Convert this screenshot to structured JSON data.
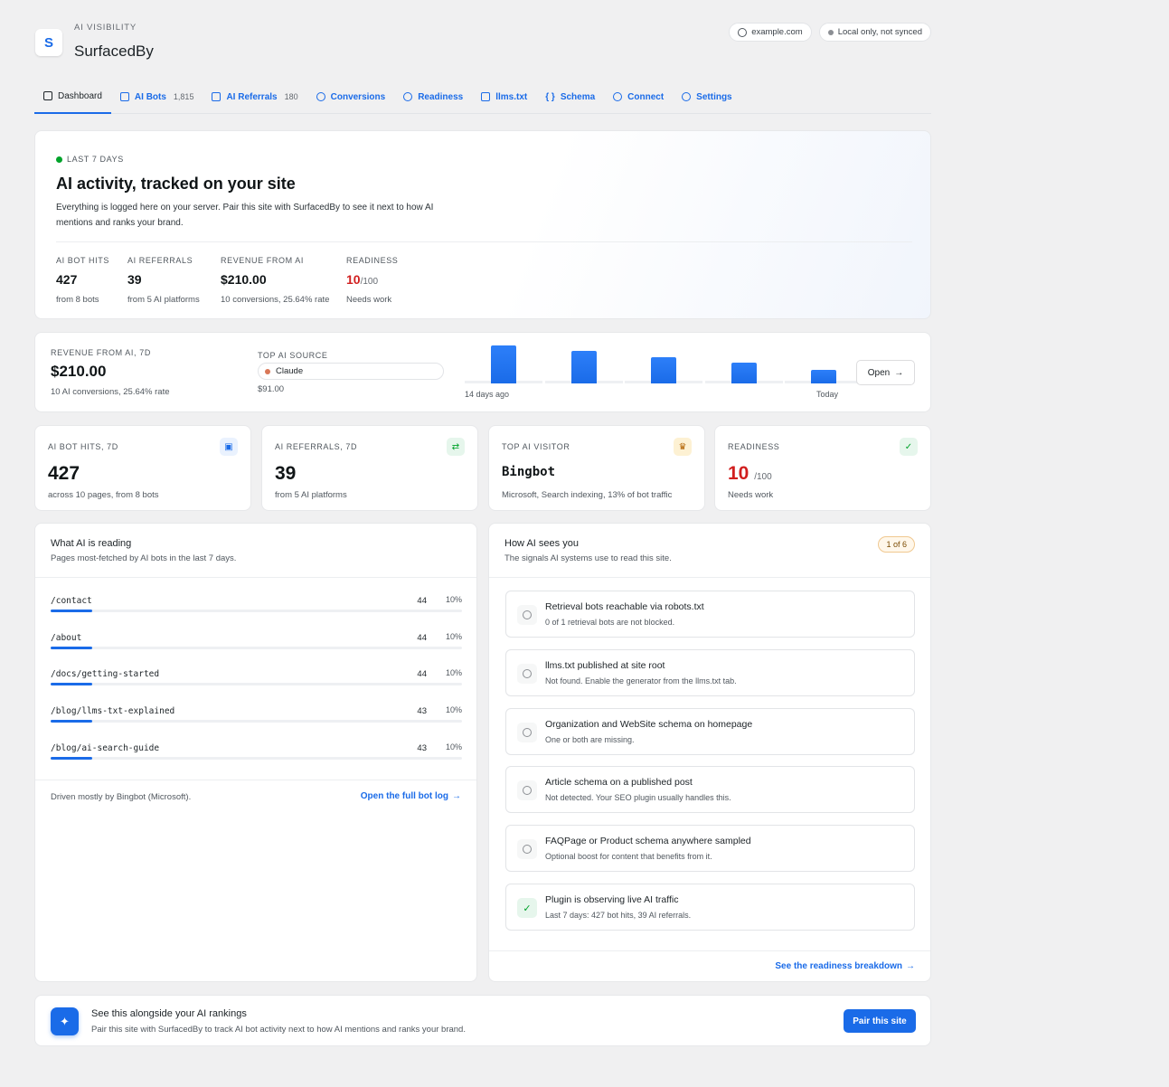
{
  "header": {
    "logo_letter": "S",
    "eyebrow": "AI VISIBILITY",
    "brand": "SurfacedBy",
    "domain_chip": "example.com",
    "sync_chip": "Local only, not synced"
  },
  "tabs": [
    {
      "label": "Dashboard",
      "count": ""
    },
    {
      "label": "AI Bots",
      "count": "1,815"
    },
    {
      "label": "AI Referrals",
      "count": "180"
    },
    {
      "label": "Conversions",
      "count": ""
    },
    {
      "label": "Readiness",
      "count": ""
    },
    {
      "label": "llms.txt",
      "count": ""
    },
    {
      "label": "Schema",
      "count": ""
    },
    {
      "label": "Connect",
      "count": ""
    },
    {
      "label": "Settings",
      "count": ""
    }
  ],
  "hero": {
    "period": "LAST 7 DAYS",
    "title": "AI activity, tracked on your site",
    "description": "Everything is logged here on your server. Pair this site with SurfacedBy to see it next to how AI mentions and ranks your brand.",
    "kpis": [
      {
        "label": "AI BOT HITS",
        "value": "427",
        "sub": "from 8 bots"
      },
      {
        "label": "AI REFERRALS",
        "value": "39",
        "sub": "from 5 AI platforms"
      },
      {
        "label": "REVENUE FROM AI",
        "value": "$210.00",
        "sub": "10 conversions, 25.64% rate"
      },
      {
        "label": "READINESS",
        "value": "10",
        "denominator": "/100",
        "sub": "Needs work"
      }
    ]
  },
  "revenue": {
    "label": "REVENUE FROM AI, 7D",
    "value": "$210.00",
    "sub": "10 AI conversions, 25.64% rate",
    "top_source_label": "TOP AI SOURCE",
    "top_source_name": "Claude",
    "top_source_value": "$91.00",
    "axis_start": "14 days ago",
    "axis_end": "Today",
    "open_label": "Open",
    "bar_levels": [
      1.0,
      0.85,
      0.7,
      0.55,
      0.35
    ]
  },
  "stats": [
    {
      "label": "AI BOT HITS, 7D",
      "value": "427",
      "sub": "across 10 pages, from 8 bots",
      "icon": "bot-icon"
    },
    {
      "label": "AI REFERRALS, 7D",
      "value": "39",
      "sub": "from 5 AI platforms",
      "icon": "referral-icon"
    },
    {
      "label": "TOP AI VISITOR",
      "value": "Bingbot",
      "sub": "Microsoft, Search indexing, 13% of bot traffic",
      "icon": "crown-icon"
    },
    {
      "label": "READINESS",
      "value": "10",
      "denominator": "/100",
      "sub": "Needs work",
      "icon": "check-circle-icon"
    }
  ],
  "reading": {
    "title": "What AI is reading",
    "desc": "Pages most-fetched by AI bots in the last 7 days.",
    "rows": [
      {
        "path": "/contact",
        "count": "44",
        "pct": "10%",
        "fill": 0.1
      },
      {
        "path": "/about",
        "count": "44",
        "pct": "10%",
        "fill": 0.1
      },
      {
        "path": "/docs/getting-started",
        "count": "44",
        "pct": "10%",
        "fill": 0.1
      },
      {
        "path": "/blog/llms-txt-explained",
        "count": "43",
        "pct": "10%",
        "fill": 0.1
      },
      {
        "path": "/blog/ai-search-guide",
        "count": "43",
        "pct": "10%",
        "fill": 0.1
      }
    ],
    "footer": "Driven mostly by Bingbot (Microsoft).",
    "link": "Open the full bot log"
  },
  "sees": {
    "title": "How AI sees you",
    "desc": "The signals AI systems use to read this site.",
    "progress": "1 of 6",
    "checks": [
      {
        "title": "Retrieval bots reachable via robots.txt",
        "desc": "0 of 1 retrieval bots are not blocked.",
        "done": false
      },
      {
        "title": "llms.txt published at site root",
        "desc": "Not found. Enable the generator from the llms.txt tab.",
        "done": false
      },
      {
        "title": "Organization and WebSite schema on homepage",
        "desc": "One or both are missing.",
        "done": false
      },
      {
        "title": "Article schema on a published post",
        "desc": "Not detected. Your SEO plugin usually handles this.",
        "done": false
      },
      {
        "title": "FAQPage or Product schema anywhere sampled",
        "desc": "Optional boost for content that benefits from it.",
        "done": false
      },
      {
        "title": "Plugin is observing live AI traffic",
        "desc": "Last 7 days: 427 bot hits, 39 AI referrals.",
        "done": true
      }
    ],
    "link": "See the readiness breakdown"
  },
  "pair": {
    "title": "See this alongside your AI rankings",
    "desc": "Pair this site with SurfacedBy to track AI bot activity next to how AI mentions and ranks your brand.",
    "button": "Pair this site"
  },
  "colors": {
    "accent": "#1a6be8",
    "danger": "#d11f1f",
    "live": "#00a32a",
    "claude": "#d97757"
  }
}
